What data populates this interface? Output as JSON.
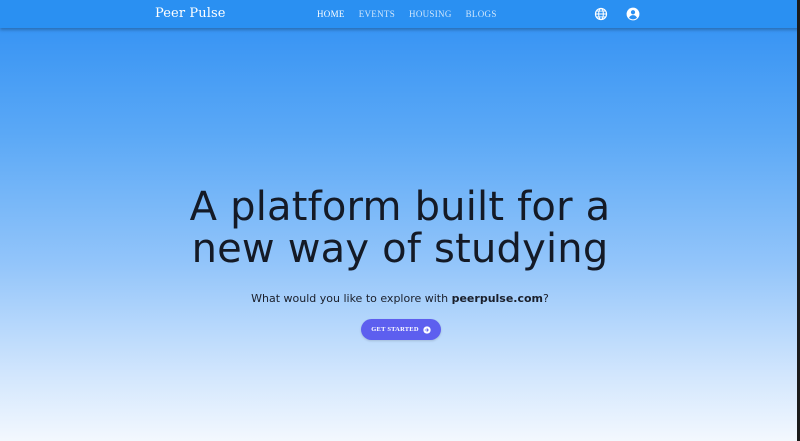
{
  "header": {
    "brand": "Peer Pulse",
    "nav": [
      {
        "label": "HOME",
        "active": true
      },
      {
        "label": "EVENTS",
        "active": false
      },
      {
        "label": "HOUSING",
        "active": false
      },
      {
        "label": "BLOGS",
        "active": false
      }
    ],
    "icons": [
      "globe-icon",
      "account-icon"
    ]
  },
  "hero": {
    "title_line1": "A platform built for a",
    "title_line2": "new way of studying",
    "subtitle_prefix": "What would you like to explore with ",
    "subtitle_site": "peerpulse.com",
    "subtitle_suffix": "?",
    "cta_label": "GET STARTED",
    "cta_icon": "arrow-right-circle-icon"
  },
  "colors": {
    "navbar": "#2a90f2",
    "gradient_top": "#2f8ff3",
    "gradient_bottom": "#f3f8fe",
    "cta": "#5d5fef",
    "title_text": "#141a26"
  }
}
